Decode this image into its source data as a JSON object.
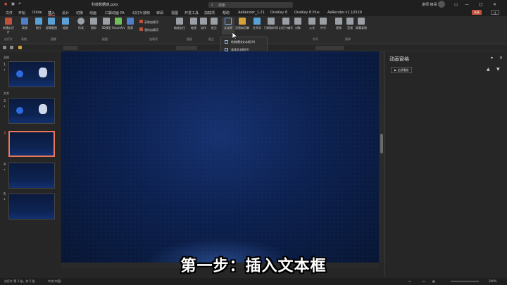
{
  "titlebar": {
    "filename": "科技数据感.pptx",
    "search_placeholder": "搜索",
    "user": "讲师 锋哥"
  },
  "menu": {
    "items": [
      "文件",
      "开始",
      "iSlide",
      "插入",
      "设计",
      "切换",
      "动画",
      "口袋动画 PA",
      "幻灯片放映",
      "审阅",
      "视图",
      "开发工具",
      "加载项",
      "帮助",
      "AeRender_1.21",
      "OneKey 8",
      "OneKey 8 Plus",
      "AeRender.v1.10329"
    ],
    "active_index": 3,
    "share_label": "共享",
    "comment_label": "注"
  },
  "ribbon": {
    "buttons": [
      {
        "label": "新建幻灯片",
        "color": "#c0523a"
      },
      {
        "label": "表格",
        "color": "#4f7fc6"
      },
      {
        "label": "图片",
        "color": "#5aa1d6"
      },
      {
        "label": "屏幕截图",
        "color": "#5aa1d6"
      },
      {
        "label": "相册",
        "color": "#5aa1d6"
      },
      {
        "label": "形状",
        "color": "#9aa0a6"
      },
      {
        "label": "图标",
        "color": "#9aa0a6"
      },
      {
        "label": "3D模型",
        "color": "#9aa0a6"
      },
      {
        "label": "SmartArt",
        "color": "#6fbf5a"
      },
      {
        "label": "图表",
        "color": "#4f7fc6"
      },
      {
        "label": "获取加载项",
        "color": "#c0523a"
      },
      {
        "label": "我的加载项",
        "color": "#c0523a"
      },
      {
        "label": "缩放定位",
        "color": "#9aa0a6"
      },
      {
        "label": "链接",
        "color": "#9aa0a6"
      },
      {
        "label": "动作",
        "color": "#9aa0a6"
      },
      {
        "label": "批注",
        "color": "#9aa0a6"
      },
      {
        "label": "文本框",
        "color": "#6ea6e6"
      },
      {
        "label": "页眉和页脚",
        "color": "#d6a23a"
      },
      {
        "label": "艺术字",
        "color": "#5aa1d6"
      },
      {
        "label": "日期和时间",
        "color": "#9aa0a6"
      },
      {
        "label": "幻灯片编号",
        "color": "#9aa0a6"
      },
      {
        "label": "对象",
        "color": "#9aa0a6"
      },
      {
        "label": "公式",
        "color": "#9aa0a6"
      },
      {
        "label": "符号",
        "color": "#9aa0a6"
      },
      {
        "label": "视频",
        "color": "#9aa0a6"
      },
      {
        "label": "音频",
        "color": "#9aa0a6"
      },
      {
        "label": "屏幕录制",
        "color": "#9aa0a6"
      }
    ],
    "groups": [
      "幻灯片",
      "表格",
      "图像",
      "插图",
      "加载项",
      "链接",
      "批注",
      "符号",
      "媒体"
    ]
  },
  "dropdown": {
    "items": [
      "绘制横排文本框(H)",
      "竖排文本框(V)"
    ]
  },
  "thumbnails": {
    "sections": [
      "总结",
      "文本"
    ],
    "slides": [
      {
        "num": "1",
        "star": "★"
      },
      {
        "num": "2",
        "star": "★"
      },
      {
        "num": "3",
        "star": ""
      },
      {
        "num": "4",
        "star": "★"
      },
      {
        "num": "5",
        "star": "★"
      }
    ],
    "selected_index": 2,
    "sidebar_label": "幻灯片"
  },
  "anim_pane": {
    "title": "动画窗格",
    "play_all_label": "全部播放"
  },
  "status": {
    "slide_info": "幻灯片 第 3 张，共 5 张",
    "language": "中文(中国)",
    "zoom": "200%"
  },
  "caption": "第一步：插入文本框"
}
